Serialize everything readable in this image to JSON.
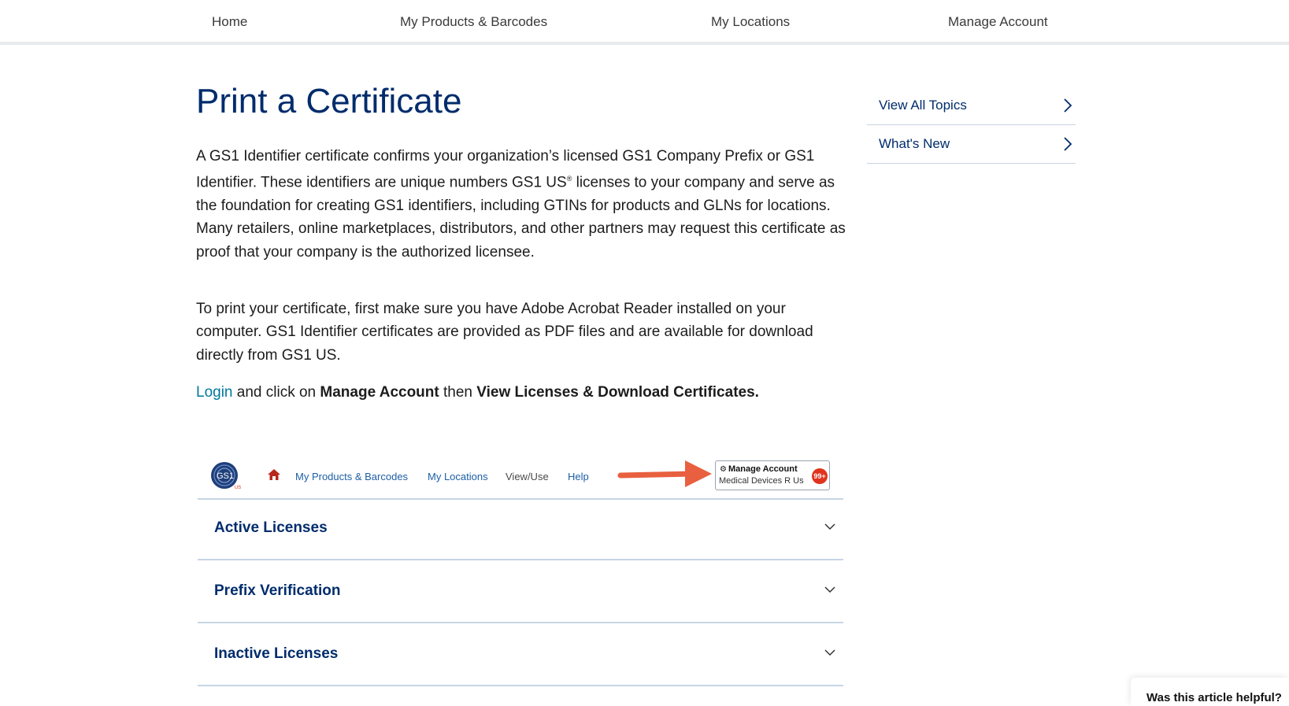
{
  "top_nav": {
    "items": [
      {
        "label": "Home"
      },
      {
        "label": "My Products & Barcodes"
      },
      {
        "label": "My Locations"
      },
      {
        "label": "Manage Account"
      }
    ]
  },
  "article": {
    "title": "Print a Certificate",
    "para1_before": "A GS1 Identifier certificate confirms your organization’s licensed GS1 Company Prefix or GS1 Identifier. These identifiers are unique numbers GS1 US",
    "para1_reg": "®",
    "para1_after": " licenses to your company and serve as the foundation for creating GS1 identifiers, including GTINs for products and GLNs for locations. Many retailers, online marketplaces, distributors, and other partners may request this certificate as proof that your company is the authorized licensee.",
    "para2": "To print your certificate, first make sure you have Adobe Acrobat Reader installed on your computer. GS1 Identifier certificates are provided as PDF files and are available for download directly from GS1 US.",
    "step": {
      "login_link": "Login",
      "text1": " and click on ",
      "bold1": "Manage Account",
      "text2": " then ",
      "bold2": "View Licenses & Download Certificates."
    }
  },
  "sidebar": {
    "links": [
      {
        "label": "View All Topics"
      },
      {
        "label": "What's New"
      }
    ]
  },
  "screenshot": {
    "logo_text": "GS1",
    "logo_sub": "US",
    "nav": [
      "My Products & Barcodes",
      "My Locations",
      "View/Use",
      "Help"
    ],
    "manage_title": "Manage Account",
    "manage_sub": "Medical Devices R Us",
    "badge": "99+",
    "colors": {
      "arrow": "#e8603f",
      "badge": "#e0331d",
      "home_icon": "#b8261b"
    }
  },
  "accordion": {
    "items": [
      {
        "label": "Active Licenses"
      },
      {
        "label": "Prefix Verification"
      },
      {
        "label": "Inactive Licenses"
      }
    ]
  },
  "feedback": {
    "label": "Was this article helpful?"
  },
  "colors": {
    "brand_navy": "#002c6c",
    "link_teal": "#00799e",
    "divider": "#c8d5e6"
  }
}
